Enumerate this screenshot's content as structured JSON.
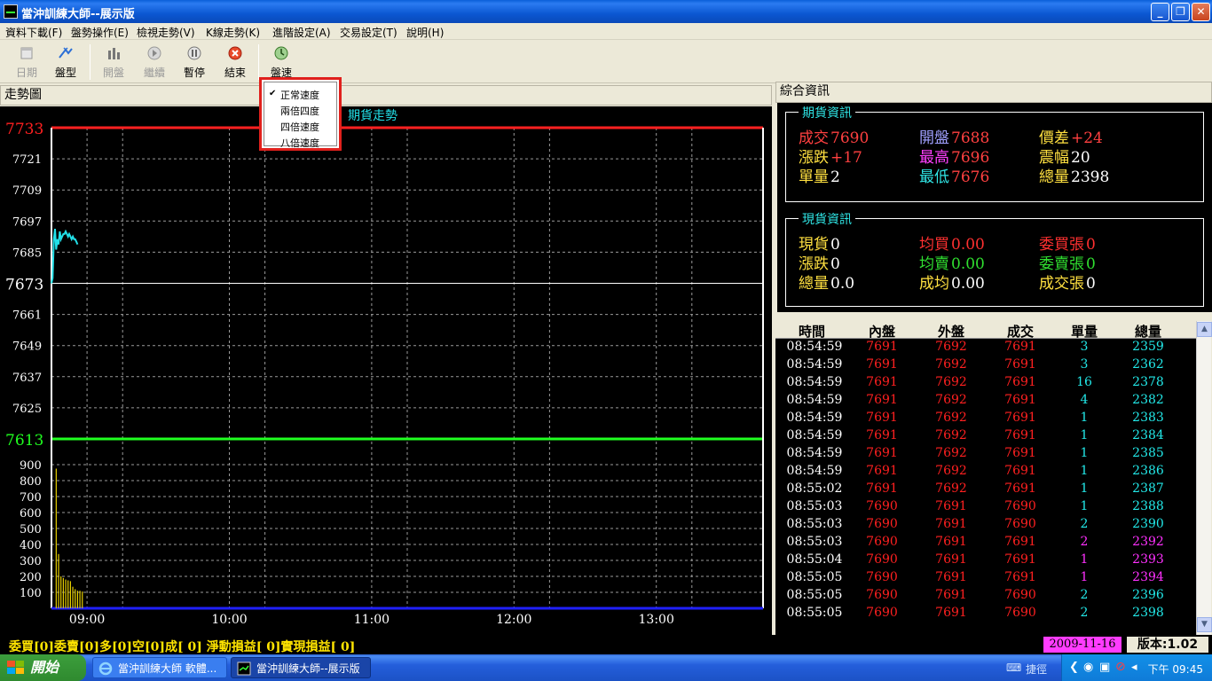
{
  "window": {
    "title": "當沖訓練大師--展示版",
    "min": "_",
    "max": "❐",
    "close": "✕"
  },
  "menu": [
    "資料下載(F)",
    "盤勢操作(E)",
    "檢視走勢(V)",
    "K線走勢(K)",
    "進階設定(A)",
    "交易設定(T)",
    "說明(H)"
  ],
  "toolbar": [
    {
      "label": "日期",
      "enabled": false
    },
    {
      "label": "盤型",
      "enabled": true
    },
    {
      "label": "開盤",
      "enabled": false
    },
    {
      "label": "繼續",
      "enabled": false
    },
    {
      "label": "暫停",
      "enabled": true
    },
    {
      "label": "結束",
      "enabled": true
    },
    {
      "label": "盤速",
      "enabled": true
    }
  ],
  "speed_menu": {
    "checked_mark": "✔",
    "items": [
      "正常速度",
      "兩倍四度",
      "四倍速度",
      "八倍速度"
    ],
    "checked_index": 0
  },
  "panels": {
    "chart_title": "走勢圖",
    "info_title": "綜合資訊"
  },
  "chart_data": {
    "type": "line",
    "title": "期貨走勢",
    "price_axis": {
      "ticks": [
        "7733",
        "7721",
        "7709",
        "7697",
        "7685",
        "7673",
        "7661",
        "7649",
        "7637",
        "7625",
        "7613"
      ],
      "max": 7733,
      "min": 7613,
      "ref": 7673,
      "max_color": "#ff2020",
      "ref_color": "#ffffff",
      "min_color": "#20ff20"
    },
    "volume_axis": {
      "ticks": [
        "900",
        "800",
        "700",
        "600",
        "500",
        "400",
        "300",
        "200",
        "100"
      ],
      "max": 950
    },
    "time_axis": {
      "ticks": [
        "09:00",
        "10:00",
        "11:00",
        "12:00",
        "13:00"
      ],
      "start_minute": 525,
      "end_minute": 825
    },
    "price_series": {
      "color": "#22e0e8",
      "points": [
        [
          525.0,
          7673
        ],
        [
          525.5,
          7675
        ],
        [
          526.0,
          7690
        ],
        [
          526.5,
          7694
        ],
        [
          527.0,
          7686
        ],
        [
          527.5,
          7690
        ],
        [
          528.0,
          7688
        ],
        [
          528.5,
          7693
        ],
        [
          529.0,
          7690
        ],
        [
          529.5,
          7691
        ],
        [
          530.0,
          7692
        ],
        [
          530.5,
          7692
        ],
        [
          531.0,
          7693
        ],
        [
          531.5,
          7692
        ],
        [
          532.0,
          7691
        ],
        [
          532.5,
          7692
        ],
        [
          533.0,
          7691
        ],
        [
          533.5,
          7690
        ],
        [
          534.0,
          7691
        ],
        [
          534.5,
          7690
        ],
        [
          535.0,
          7690
        ],
        [
          535.5,
          7689
        ],
        [
          536.0,
          7688
        ]
      ]
    },
    "volume_series": {
      "color": "#e8d000",
      "bars": [
        [
          527,
          875
        ],
        [
          528,
          340
        ],
        [
          529,
          200
        ],
        [
          530,
          190
        ],
        [
          531,
          180
        ],
        [
          532,
          175
        ],
        [
          533,
          170
        ],
        [
          534,
          135
        ],
        [
          535,
          120
        ],
        [
          536,
          110
        ],
        [
          537,
          110
        ],
        [
          538,
          105
        ]
      ]
    }
  },
  "futures_info": {
    "legend": "期貨資訊",
    "cells": [
      {
        "k": "成交",
        "v": "7690",
        "kc": "#ff4040",
        "vc": "#ff4040"
      },
      {
        "k": "開盤",
        "v": "7688",
        "kc": "#a0a0ff",
        "vc": "#ff4040"
      },
      {
        "k": "價差",
        "v": "+24",
        "kc": "#ffe040",
        "vc": "#ff4040"
      },
      {
        "k": "漲跌",
        "v": "+17",
        "kc": "#ffe040",
        "vc": "#ff4040"
      },
      {
        "k": "最高",
        "v": "7696",
        "kc": "#ff40ff",
        "vc": "#ff4040"
      },
      {
        "k": "震幅",
        "v": "20",
        "kc": "#ffe040",
        "vc": "#ffffff"
      },
      {
        "k": "單量",
        "v": "2",
        "kc": "#ffe040",
        "vc": "#ffffff"
      },
      {
        "k": "最低",
        "v": "7676",
        "kc": "#30e5e5",
        "vc": "#ff4040"
      },
      {
        "k": "總量",
        "v": "2398",
        "kc": "#ffe040",
        "vc": "#ffffff"
      }
    ]
  },
  "spot_info": {
    "legend": "現貨資訊",
    "cells": [
      {
        "k": "現貨",
        "v": "0",
        "kc": "#ffe040",
        "vc": "#ffffff"
      },
      {
        "k": "均買",
        "v": "0.00",
        "kc": "#ff3030",
        "vc": "#ff3030"
      },
      {
        "k": "委買張",
        "v": "0",
        "kc": "#ff3030",
        "vc": "#ff3030"
      },
      {
        "k": "漲跌",
        "v": "0",
        "kc": "#ffe040",
        "vc": "#ffffff"
      },
      {
        "k": "均賣",
        "v": "0.00",
        "kc": "#30e030",
        "vc": "#30e030"
      },
      {
        "k": "委賣張",
        "v": "0",
        "kc": "#30e030",
        "vc": "#30e030"
      },
      {
        "k": "總量",
        "v": "0.0",
        "kc": "#ffe040",
        "vc": "#ffffff"
      },
      {
        "k": "成均",
        "v": "0.00",
        "kc": "#ffe040",
        "vc": "#ffffff"
      },
      {
        "k": "成交張",
        "v": "0",
        "kc": "#ffe040",
        "vc": "#ffffff"
      }
    ]
  },
  "trades": {
    "headers": [
      "時間",
      "內盤",
      "外盤",
      "成交",
      "單量",
      "總量"
    ],
    "rows": [
      [
        "08:54:59",
        "7691",
        "7692",
        "7691",
        "3",
        "2359",
        "cyan"
      ],
      [
        "08:54:59",
        "7691",
        "7692",
        "7691",
        "3",
        "2362",
        "cyan"
      ],
      [
        "08:54:59",
        "7691",
        "7692",
        "7691",
        "16",
        "2378",
        "cyan"
      ],
      [
        "08:54:59",
        "7691",
        "7692",
        "7691",
        "4",
        "2382",
        "cyan"
      ],
      [
        "08:54:59",
        "7691",
        "7692",
        "7691",
        "1",
        "2383",
        "cyan"
      ],
      [
        "08:54:59",
        "7691",
        "7692",
        "7691",
        "1",
        "2384",
        "cyan"
      ],
      [
        "08:54:59",
        "7691",
        "7692",
        "7691",
        "1",
        "2385",
        "cyan"
      ],
      [
        "08:54:59",
        "7691",
        "7692",
        "7691",
        "1",
        "2386",
        "cyan"
      ],
      [
        "08:55:02",
        "7691",
        "7692",
        "7691",
        "1",
        "2387",
        "cyan"
      ],
      [
        "08:55:03",
        "7690",
        "7691",
        "7690",
        "1",
        "2388",
        "cyan"
      ],
      [
        "08:55:03",
        "7690",
        "7691",
        "7690",
        "2",
        "2390",
        "cyan"
      ],
      [
        "08:55:03",
        "7690",
        "7691",
        "7691",
        "2",
        "2392",
        "magenta"
      ],
      [
        "08:55:04",
        "7690",
        "7691",
        "7691",
        "1",
        "2393",
        "magenta"
      ],
      [
        "08:55:05",
        "7690",
        "7691",
        "7691",
        "1",
        "2394",
        "magenta"
      ],
      [
        "08:55:05",
        "7690",
        "7691",
        "7690",
        "2",
        "2396",
        "cyan"
      ],
      [
        "08:55:05",
        "7690",
        "7691",
        "7690",
        "2",
        "2398",
        "cyan"
      ]
    ]
  },
  "status": {
    "text": "委買[0]委賣[0]多[0]空[0]成[ 0] 淨動損益[   0]實現損益[   0]",
    "date": "2009-11-16",
    "version": "版本:1.02"
  },
  "taskbar": {
    "start": "開始",
    "tasks": [
      "當沖訓練大師 軟體...",
      "當沖訓練大師--展示版"
    ],
    "quick": "捷徑",
    "clock": "下午 09:45"
  },
  "colors": {
    "chart_bg": "#000000",
    "grid": "#9a9a9a",
    "axis": "#ffffff",
    "bottom_axis": "#2020ff",
    "cyan": "#22e8e8",
    "magenta": "#ff30ff",
    "red": "#ff2020"
  }
}
